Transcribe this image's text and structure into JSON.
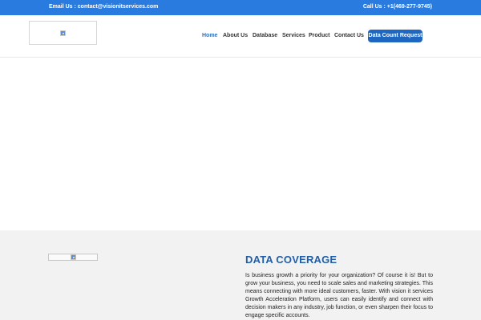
{
  "topbar": {
    "email": "Email Us : contact@visionitservices.com",
    "phone": "Call Us : +1(469-277-9745)"
  },
  "nav": {
    "items": [
      {
        "label": "Home",
        "active": true
      },
      {
        "label": "About Us",
        "active": false
      },
      {
        "label": "Database",
        "active": false
      },
      {
        "label": "Services",
        "active": false
      },
      {
        "label": "Product",
        "active": false
      },
      {
        "label": "Contact Us",
        "active": false
      }
    ],
    "cta_label": "Data Count Request"
  },
  "coverage": {
    "title": "DATA COVERAGE",
    "text": "Is business growth a priority for your organization? Of course it is! But to grow your business, you need to scale sales and marketing strategies. This means connecting with more ideal customers, faster. With vision it services Growth Acceleration Platform, users can easily identify and connect with decision makers in any industry, job function, or even sharpen their focus to engage specific accounts."
  },
  "colors": {
    "brand_blue": "#2a7be0",
    "nav_active": "#2a6fc1",
    "cta_bg": "#1f66c1",
    "title_blue": "#1f5ea8"
  }
}
